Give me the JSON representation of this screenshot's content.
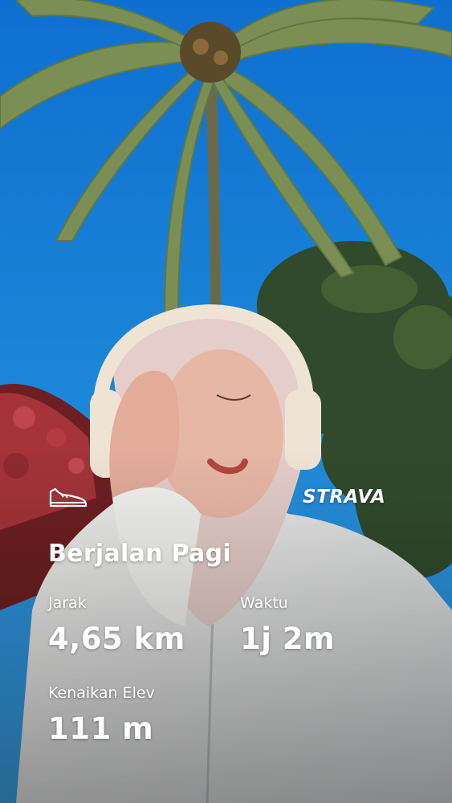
{
  "activity": {
    "icon": "shoe-icon",
    "title": "Berjalan Pagi"
  },
  "brand": {
    "name": "STRAVA"
  },
  "stats": {
    "distance": {
      "label": "Jarak",
      "value": "4,65 km"
    },
    "time": {
      "label": "Waktu",
      "value": "1j 2m"
    },
    "elevation": {
      "label": "Kenaikan Elev",
      "value": "111 m"
    }
  },
  "colors": {
    "sky": "#1c87d8",
    "text": "#ffffff",
    "foliage": "#2f4a2a",
    "flowers": "#a4333a",
    "jacket": "#e9e8e6"
  }
}
